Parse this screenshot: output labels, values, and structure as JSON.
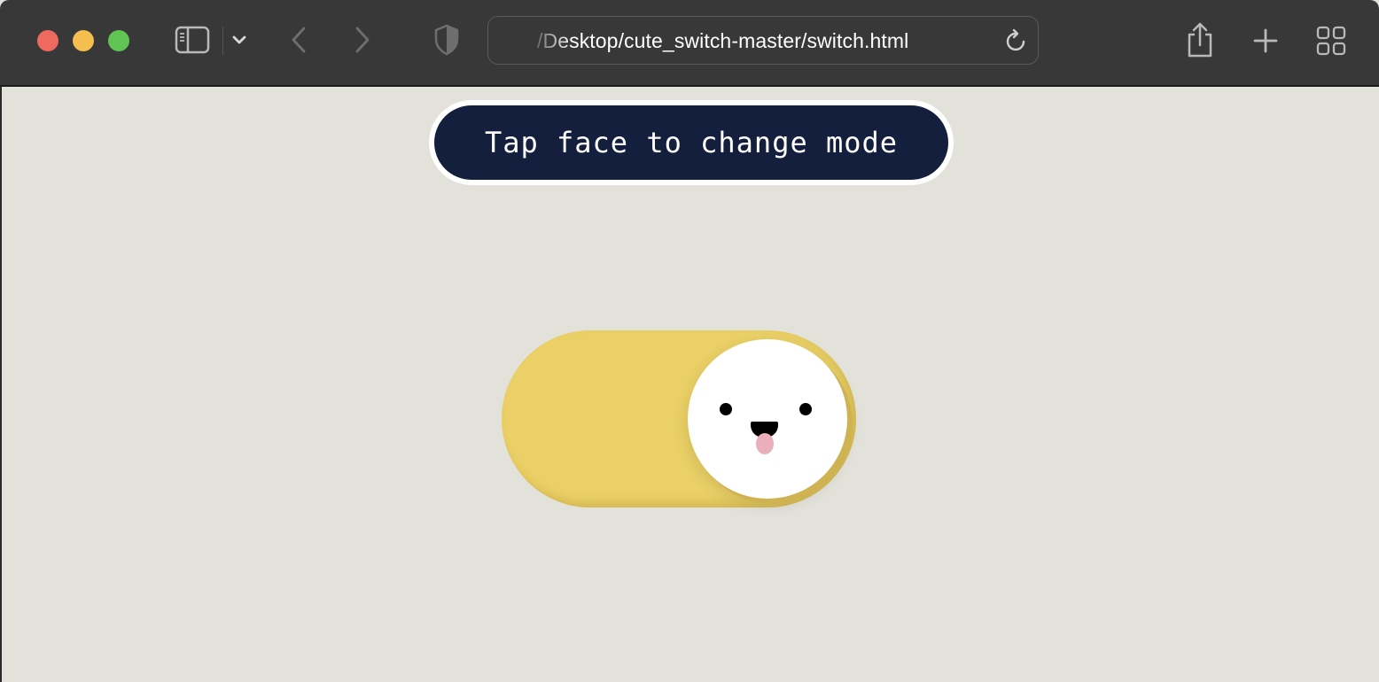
{
  "browser": {
    "url": "/Desktop/cute_switch-master/switch.html",
    "icons": {
      "sidebar": "sidebar-icon",
      "tab_group_menu": "chevron-down-icon",
      "back": "chevron-left-icon",
      "forward": "chevron-right-icon",
      "privacy": "shield-icon",
      "reload": "reload-icon",
      "share": "share-icon",
      "new_tab": "plus-icon",
      "tab_overview": "grid-icon"
    },
    "colors": {
      "toolbar": "#383838",
      "close": "#ee6a5e",
      "minimize": "#f5be4f",
      "zoom": "#61c554"
    }
  },
  "page": {
    "hint": "Tap face to change mode",
    "background": "#e2e1da",
    "switch": {
      "state": "on",
      "track_color": "#ead066",
      "knob_color": "#ffffff",
      "face": "smiling-face-tongue-out"
    }
  }
}
